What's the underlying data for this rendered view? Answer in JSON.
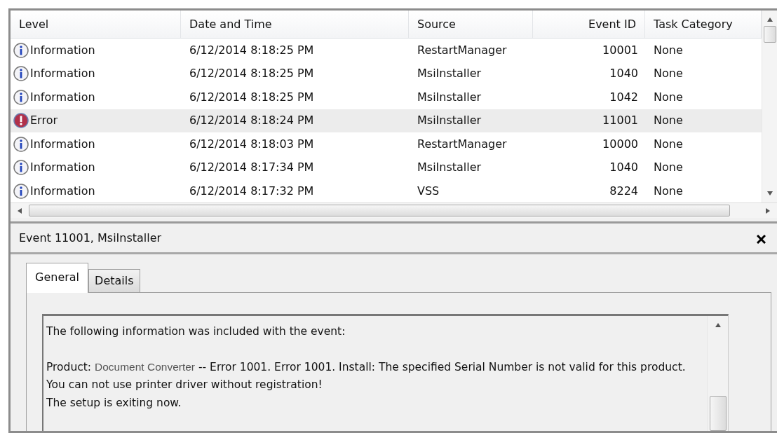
{
  "table": {
    "columns": [
      {
        "label": "Level",
        "kind": "text"
      },
      {
        "label": "Date and Time",
        "kind": "text"
      },
      {
        "label": "Source",
        "kind": "text"
      },
      {
        "label": "Event ID",
        "kind": "number"
      },
      {
        "label": "Task Category",
        "kind": "text"
      }
    ],
    "rows": [
      {
        "kind": "information",
        "level": "Information",
        "date": "6/12/2014 8:18:25 PM",
        "source": "RestartManager",
        "event_id": "10001",
        "task_category": "None",
        "selected": false
      },
      {
        "kind": "information",
        "level": "Information",
        "date": "6/12/2014 8:18:25 PM",
        "source": "MsiInstaller",
        "event_id": "1040",
        "task_category": "None",
        "selected": false
      },
      {
        "kind": "information",
        "level": "Information",
        "date": "6/12/2014 8:18:25 PM",
        "source": "MsiInstaller",
        "event_id": "1042",
        "task_category": "None",
        "selected": false
      },
      {
        "kind": "error",
        "level": "Error",
        "date": "6/12/2014 8:18:24 PM",
        "source": "MsiInstaller",
        "event_id": "11001",
        "task_category": "None",
        "selected": true
      },
      {
        "kind": "information",
        "level": "Information",
        "date": "6/12/2014 8:18:03 PM",
        "source": "RestartManager",
        "event_id": "10000",
        "task_category": "None",
        "selected": false
      },
      {
        "kind": "information",
        "level": "Information",
        "date": "6/12/2014 8:17:34 PM",
        "source": "MsiInstaller",
        "event_id": "1040",
        "task_category": "None",
        "selected": false
      },
      {
        "kind": "information",
        "level": "Information",
        "date": "6/12/2014 8:17:32 PM",
        "source": "VSS",
        "event_id": "8224",
        "task_category": "None",
        "selected": false
      }
    ]
  },
  "details": {
    "title": "Event 11001, MsiInstaller",
    "tabs": [
      {
        "label": "General",
        "selected": true
      },
      {
        "label": "Details",
        "selected": false
      }
    ],
    "message": [
      {
        "lines": [
          {
            "parts": [
              {
                "kind": "plain",
                "text": "The following information was included with the event:"
              }
            ]
          }
        ]
      },
      {
        "lines": [
          {
            "parts": [
              {
                "kind": "plain",
                "text": "Product:"
              },
              {
                "kind": "inserted",
                "text": "Document Converter"
              },
              {
                "kind": "plain",
                "text": "-- Error 1001. Error 1001. Install: The specified Serial Number is not valid for this product."
              }
            ]
          },
          {
            "parts": [
              {
                "kind": "plain",
                "text": "You can not use printer driver without registration!"
              }
            ]
          },
          {
            "parts": [
              {
                "kind": "plain",
                "text": "The setup is exiting now."
              }
            ]
          }
        ]
      }
    ]
  }
}
